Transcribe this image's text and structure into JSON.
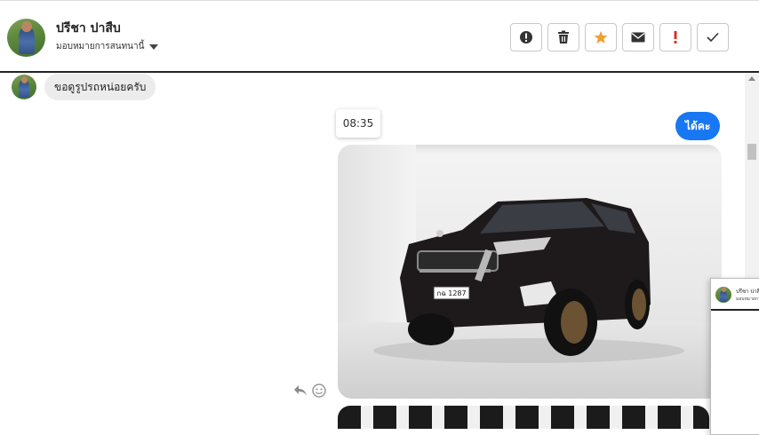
{
  "header": {
    "contact_name": "ปรีชา ปาสืบ",
    "assign_label": "มอบหมายการสนทนานี้",
    "toolbar": [
      {
        "name": "alert-icon",
        "color": "#333333"
      },
      {
        "name": "trash-icon",
        "color": "#333333"
      },
      {
        "name": "star-icon",
        "color": "#f0a030"
      },
      {
        "name": "mail-icon",
        "color": "#333333"
      },
      {
        "name": "exclamation-icon",
        "color": "#d9302c"
      },
      {
        "name": "check-icon",
        "color": "#333333"
      }
    ]
  },
  "messages": {
    "incoming_text": "ขอดูรูปรถหน่อยครับ",
    "timestamp": "08:35",
    "outgoing_text": "ได้คะ",
    "plate_text": "กฉ 1287"
  },
  "peek_panel": {
    "name": "ปรีชา ปาสืบ",
    "sub": "มอบหมายการสนทนานี้"
  },
  "colors": {
    "accent": "#1877f2",
    "incoming_bubble": "#ececec"
  }
}
